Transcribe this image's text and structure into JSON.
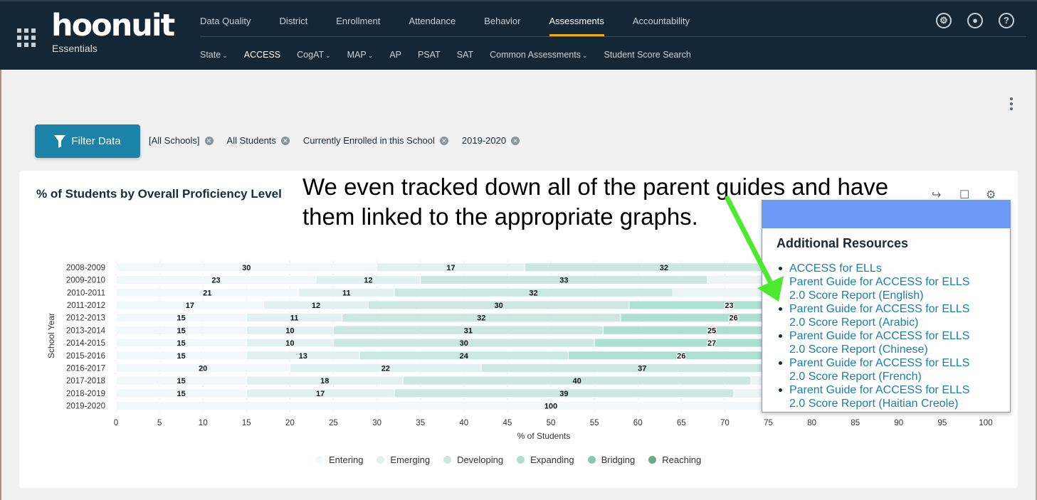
{
  "header": {
    "logo": "hoonuit",
    "logo_sub": "Essentials",
    "main_nav": [
      "Data Quality",
      "District",
      "Enrollment",
      "Attendance",
      "Behavior",
      "Assessments",
      "Accountability"
    ],
    "main_nav_active": "Assessments",
    "sub_nav": [
      {
        "label": "State",
        "dropdown": true
      },
      {
        "label": "ACCESS",
        "dropdown": false,
        "active": true
      },
      {
        "label": "CogAT",
        "dropdown": true
      },
      {
        "label": "MAP",
        "dropdown": true
      },
      {
        "label": "AP",
        "dropdown": false
      },
      {
        "label": "PSAT",
        "dropdown": false
      },
      {
        "label": "SAT",
        "dropdown": false
      },
      {
        "label": "Common Assessments",
        "dropdown": true
      },
      {
        "label": "Student Score Search",
        "dropdown": false
      }
    ],
    "icons": [
      "tools-icon",
      "user-icon",
      "help-icon"
    ]
  },
  "toolbar": {
    "filter_label": "Filter Data",
    "chips": [
      "[All Schools]",
      "All Students",
      "Currently Enrolled in this School",
      "2019-2020"
    ]
  },
  "annotation": {
    "line1": "We even tracked down all of the parent guides and have",
    "line2": "them linked to the appropriate graphs."
  },
  "popup": {
    "title": "Additional Resources",
    "header_color": "#6d9af7",
    "links": [
      [
        "ACCESS for ELLs"
      ],
      [
        "Parent Guide for ACCESS for ELLS",
        "2.0 Score Report (English)"
      ],
      [
        "Parent Guide for ACCESS for ELLS",
        "2.0 Score Report (Arabic)"
      ],
      [
        "Parent Guide for ACCESS for ELLS",
        "2.0 Score Report (Chinese)"
      ],
      [
        "Parent Guide for ACCESS for ELLS",
        "2.0 Score Report (French)"
      ],
      [
        "Parent Guide for ACCESS for ELLS",
        "2.0 Score Report (Haitian Creole)"
      ]
    ]
  },
  "chart_data": {
    "type": "bar",
    "orientation": "horizontal",
    "stacked": true,
    "title": "% of Students by Overall Proficiency Level",
    "xlabel": "% of Students",
    "ylabel": "School Year",
    "xlim": [
      0,
      100
    ],
    "xticks": [
      0,
      5,
      10,
      15,
      20,
      25,
      30,
      35,
      40,
      45,
      50,
      55,
      60,
      65,
      70,
      75,
      80,
      85,
      90,
      95,
      100
    ],
    "grid": true,
    "legend_position": "bottom",
    "categories": [
      "2008-2009",
      "2009-2010",
      "2010-2011",
      "2011-2012",
      "2012-2013",
      "2013-2014",
      "2014-2015",
      "2015-2016",
      "2016-2017",
      "2017-2018",
      "2018-2019",
      "2019-2020"
    ],
    "series": [
      {
        "name": "Entering",
        "color": "#f2f8f9",
        "values": [
          30,
          23,
          21,
          17,
          15,
          15,
          15,
          15,
          20,
          15,
          15,
          100
        ]
      },
      {
        "name": "Emerging",
        "color": "#e0f1ef",
        "values": [
          17,
          12,
          11,
          12,
          11,
          10,
          10,
          13,
          22,
          18,
          17,
          0
        ]
      },
      {
        "name": "Developing",
        "color": "#cae8e0",
        "values": [
          32,
          33,
          32,
          30,
          32,
          31,
          30,
          24,
          37,
          40,
          39,
          0
        ]
      },
      {
        "name": "Expanding",
        "color": "#ade0d1",
        "values": [
          null,
          null,
          null,
          23,
          26,
          25,
          27,
          26,
          null,
          null,
          null,
          0
        ]
      },
      {
        "name": "Bridging",
        "color": "#89c9af",
        "values": [
          null,
          null,
          null,
          null,
          null,
          null,
          null,
          null,
          null,
          null,
          null,
          0
        ]
      },
      {
        "name": "Reaching",
        "color": "#6aaa88",
        "values": [
          null,
          null,
          null,
          null,
          null,
          null,
          null,
          null,
          null,
          null,
          null,
          0
        ]
      }
    ]
  }
}
